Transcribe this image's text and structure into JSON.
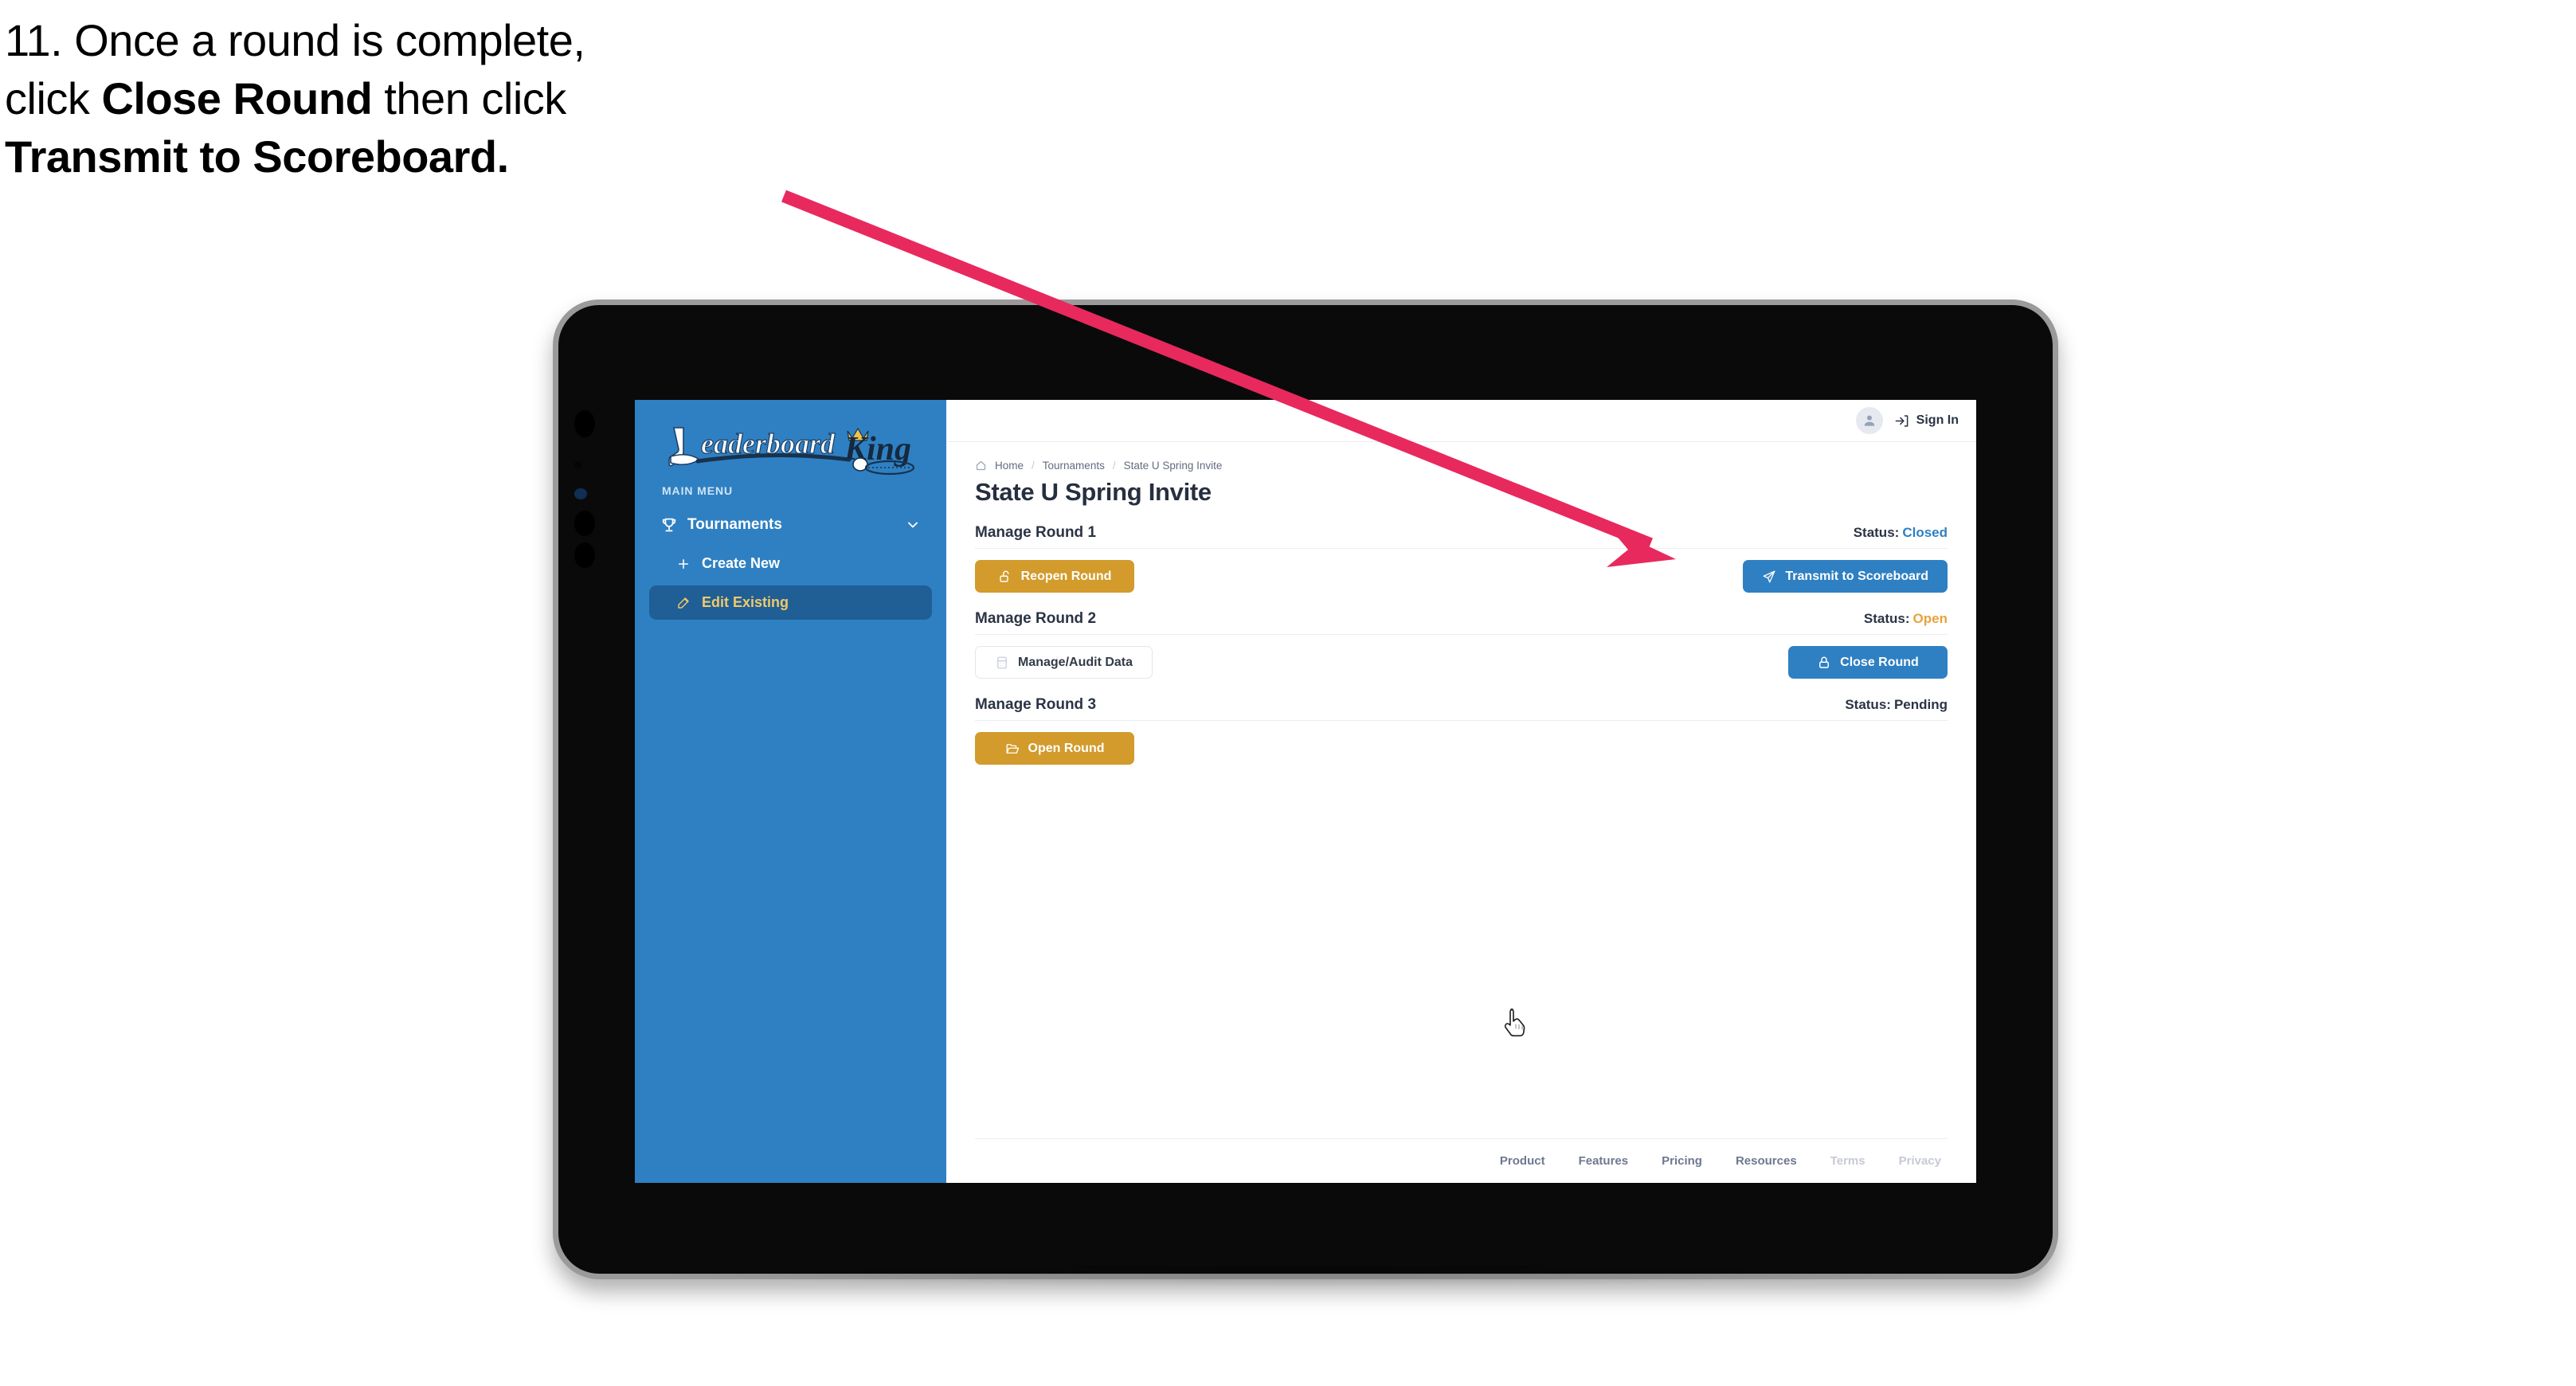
{
  "caption": {
    "line1": "11. Once a round is complete,",
    "line2_pre": "click ",
    "line2_bold": "Close Round",
    "line2_post": " then click",
    "line3_bold": "Transmit to Scoreboard."
  },
  "colors": {
    "brand_blue": "#2f80c2",
    "sidebar_active_bg": "#1f5f96",
    "sidebar_active_text": "#f0c96a",
    "gold_button": "#d29b2c",
    "status_open": "#e8a33d",
    "status_closed": "#2f80c2",
    "arrow_pink": "#e8295e",
    "tablet_body": "#0a0a0a",
    "tablet_bezel": "#9a9a9a"
  },
  "sidebar": {
    "logo_primary": "Leaderboard",
    "logo_secondary": "King",
    "menu_label": "MAIN MENU",
    "items": [
      {
        "label": "Tournaments",
        "icon": "trophy-icon",
        "chevron": "chevron-down-icon",
        "active": false
      },
      {
        "label": "Create New",
        "icon": "plus-icon",
        "active": false
      },
      {
        "label": "Edit Existing",
        "icon": "edit-pencil-icon",
        "active": true
      }
    ]
  },
  "topbar": {
    "avatar_icon": "user-avatar-icon",
    "signin_icon": "sign-in-arrow-icon",
    "signin_label": "Sign In"
  },
  "breadcrumb": {
    "home_icon": "home-icon",
    "items": [
      "Home",
      "Tournaments",
      "State U Spring Invite"
    ],
    "separator": "/"
  },
  "page": {
    "title": "State U Spring Invite"
  },
  "rounds": [
    {
      "name": "Manage Round 1",
      "status_label": "Status:",
      "status_value": "Closed",
      "status_class": "closed",
      "left_button": {
        "label": "Reopen Round",
        "style": "gold",
        "icon": "unlock-icon"
      },
      "right_button": {
        "label": "Transmit to Scoreboard",
        "style": "blue",
        "icon": "paper-plane-icon"
      }
    },
    {
      "name": "Manage Round 2",
      "status_label": "Status:",
      "status_value": "Open",
      "status_class": "open",
      "left_button": {
        "label": "Manage/Audit Data",
        "style": "ghost",
        "icon": "table-grid-icon"
      },
      "right_button": {
        "label": "Close Round",
        "style": "blue",
        "icon": "lock-icon"
      }
    },
    {
      "name": "Manage Round 3",
      "status_label": "Status:",
      "status_value": "Pending",
      "status_class": "pending",
      "left_button": {
        "label": "Open Round",
        "style": "gold",
        "icon": "open-folder-icon"
      },
      "right_button": null
    }
  ],
  "footer": {
    "links": [
      {
        "label": "Product",
        "dim": false
      },
      {
        "label": "Features",
        "dim": false
      },
      {
        "label": "Pricing",
        "dim": false
      },
      {
        "label": "Resources",
        "dim": false
      },
      {
        "label": "Terms",
        "dim": true
      },
      {
        "label": "Privacy",
        "dim": true
      }
    ]
  },
  "annotation": {
    "arrow_name": "callout-arrow",
    "points_to": "Transmit to Scoreboard"
  },
  "cursor": {
    "type": "pointer-hand-cursor"
  }
}
